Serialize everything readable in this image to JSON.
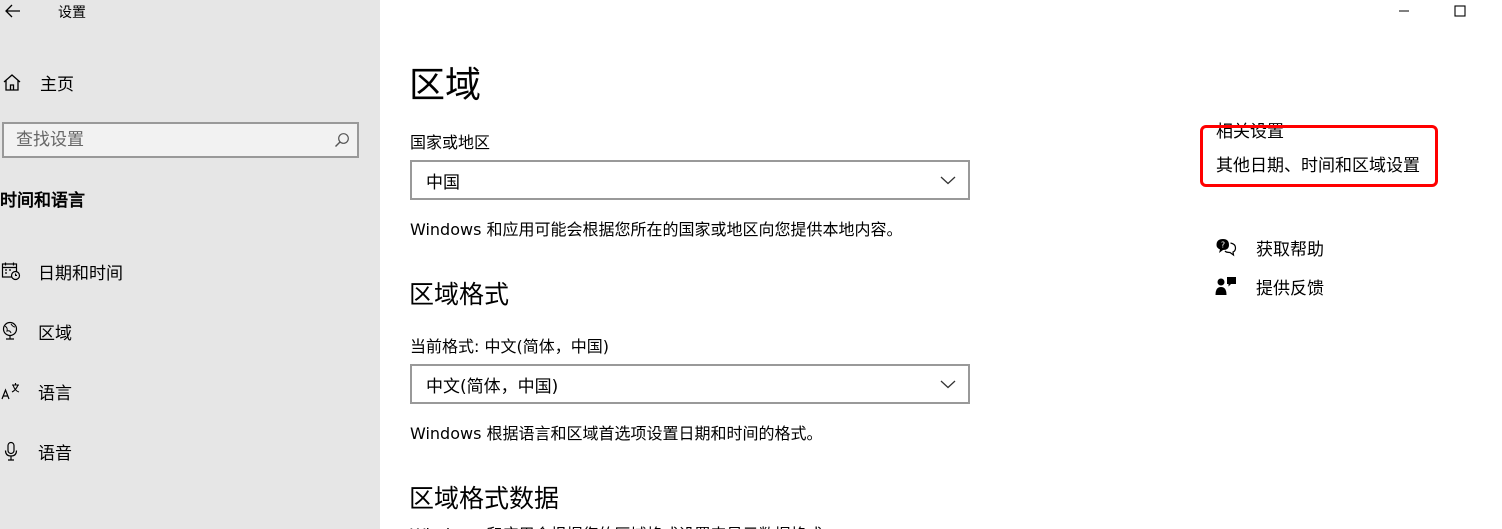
{
  "window": {
    "title": "设置",
    "back_icon": "arrow-left-icon",
    "minimize_icon": "minimize-icon",
    "maximize_icon": "maximize-icon"
  },
  "sidebar": {
    "home_label": "主页",
    "search_placeholder": "查找设置",
    "section_title": "时间和语言",
    "items": [
      {
        "label": "日期和时间",
        "icon": "calendar-clock-icon"
      },
      {
        "label": "区域",
        "icon": "globe-icon"
      },
      {
        "label": "语言",
        "icon": "language-icon"
      },
      {
        "label": "语音",
        "icon": "microphone-icon"
      }
    ]
  },
  "main": {
    "title": "区域",
    "country_label": "国家或地区",
    "country_value": "中国",
    "country_desc": "Windows 和应用可能会根据您所在的国家或地区向您提供本地内容。",
    "format_heading": "区域格式",
    "current_format_label": "当前格式: 中文(简体，中国)",
    "format_value": "中文(简体，中国)",
    "format_desc": "Windows 根据语言和区域首选项设置日期和时间的格式。",
    "format_data_heading": "区域格式数据",
    "cut_text": "Windows 和应用会根据您的区域格式设置来显示数据格式"
  },
  "related": {
    "title": "相关设置",
    "link": "其他日期、时间和区域设置",
    "help_label": "获取帮助",
    "feedback_label": "提供反馈"
  },
  "colors": {
    "sidebar_bg": "#e6e6e6",
    "highlight": "#ff0000",
    "border": "#999999"
  }
}
